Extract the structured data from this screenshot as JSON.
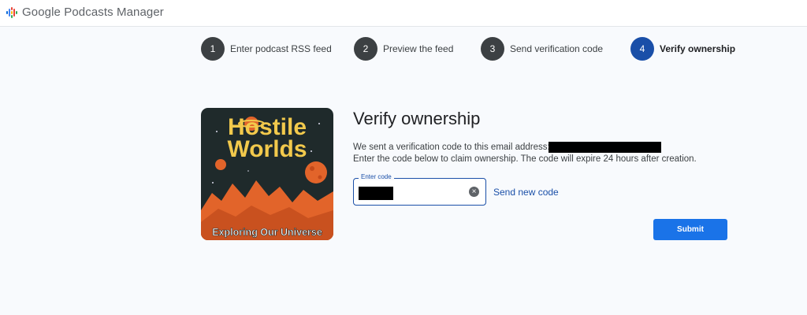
{
  "app": {
    "title": "Google Podcasts Manager",
    "logo_icon": "podcasts-logo-icon"
  },
  "steps": [
    {
      "number": "1",
      "label": "Enter podcast RSS feed",
      "active": false
    },
    {
      "number": "2",
      "label": "Preview the feed",
      "active": false
    },
    {
      "number": "3",
      "label": "Send verification code",
      "active": false
    },
    {
      "number": "4",
      "label": "Verify ownership",
      "active": true
    }
  ],
  "artwork": {
    "title_line1": "Hostile",
    "title_line2": "Worlds",
    "subtitle": "Exploring Our Universe"
  },
  "form": {
    "title": "Verify ownership",
    "desc_line1": "We sent a verification code to this email address:",
    "desc_line2": "Enter the code below to claim ownership. The code will expire 24 hours after creation.",
    "code_label": "Enter code",
    "code_value": "",
    "clear_icon": "clear-icon",
    "send_new_label": "Send new code",
    "submit_label": "Submit"
  },
  "colors": {
    "accent": "#1a4fa8",
    "submit": "#1a73e8",
    "step_inactive": "#3c4043",
    "background": "#f8fafd"
  }
}
